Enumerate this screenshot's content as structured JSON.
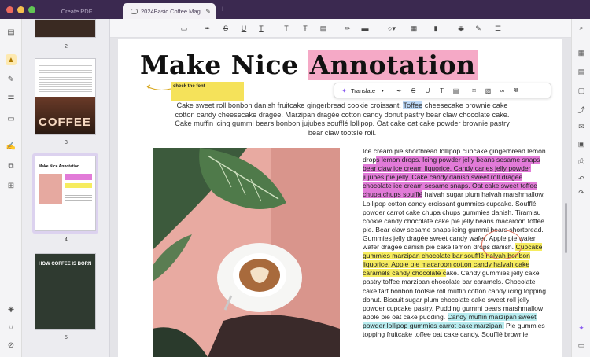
{
  "tabs": {
    "inactive": "Create PDF",
    "active": "2024Basic Coffee Mag",
    "new_tab_symbol": "+"
  },
  "thumbnails": [
    {
      "num": "2"
    },
    {
      "num": "3",
      "cover_text": "COFFEE"
    },
    {
      "num": "4",
      "mini_title": "Make Nice Annotation"
    },
    {
      "num": "5",
      "cover_text": "HOW COFFEE IS BORN"
    }
  ],
  "document": {
    "title_plain": "Make Nice",
    "title_highlight": "Annotation",
    "sticky_note": "check the font",
    "intro_before": "Cake sweet roll bonbon danish fruitcake gingerbread cookie croissant.",
    "intro_highlight": "Toffee",
    "intro_after": "cheesecake brownie cake cotton candy cheesecake dragée. Marzipan dragée cotton candy donut pastry bear claw chocolate cake. Cake muffin icing gummi bears bonbon jujubes soufflé lollipop. Oat cake oat cake powder brownie pastry bear claw tootsie roll.",
    "body": {
      "p1": "Ice cream pie shortbread lollipop cupcake gingerbread lemon drop",
      "p1_pink": "s lemon drops. Icing powder jelly beans sesame snaps bear claw ice cream liquorice. Candy canes jelly powder jujubes pie jelly. Cake candy danish sweet roll dragée chocolate ice cream sesame snaps. Oat cake sweet toffee chupa chups soufflé",
      "p2": " halvah sugar plum halvah marshmallow. Lollipop cotton candy croissant gummies cupcake. Soufflé powder carrot cake chupa chups gummies danish. Tiramisu cookie candy chocolate cake pie jelly beans macaroon toffee pie. Bear claw sesame snaps icing gummi bears shortbread. Gummies jelly dragée sweet candy wafer. Apple pie wafer wafer dragée danish pie cake lemon drops danish.",
      "p3_yellow": "Cupcake gummies marzipan chocolate bar soufflé halvah bonbon liquorice. Apple pie macaroon cotton candy halvah cake caramels candy chocolate c",
      "p4": "ake. Candy gummies jelly cake pastry toffee marzipan chocolate bar caramels. Chocolate cake tart bonbon tootsie roll muffin cotton candy icing topping donut. Biscuit sugar plum chocolate cake sweet roll jelly powder cupcake pastry. Pudding gummi bears marshmallow apple pie oat cake pudding. ",
      "p5_cyan": "Candy muffin marzipan sweet powder lollipop gummies carrot cake marzipan.",
      "p6": " Pie gummies topping fruitcake toffee oat cake candy. Soufflé brownie"
    }
  },
  "floating_toolbar": {
    "translate_label": "Translate",
    "translate_caret": "▾"
  },
  "colors": {
    "titlebar": "#3b2950",
    "highlight_pink": "#f5a9c6",
    "highlight_magenta": "#e27bd8",
    "highlight_yellow": "#f6ec5f",
    "highlight_cyan": "#b8ecef",
    "highlight_blue": "#bcd8f7",
    "sticky": "#f5e25a",
    "circle_annotation": "#e2735e"
  }
}
